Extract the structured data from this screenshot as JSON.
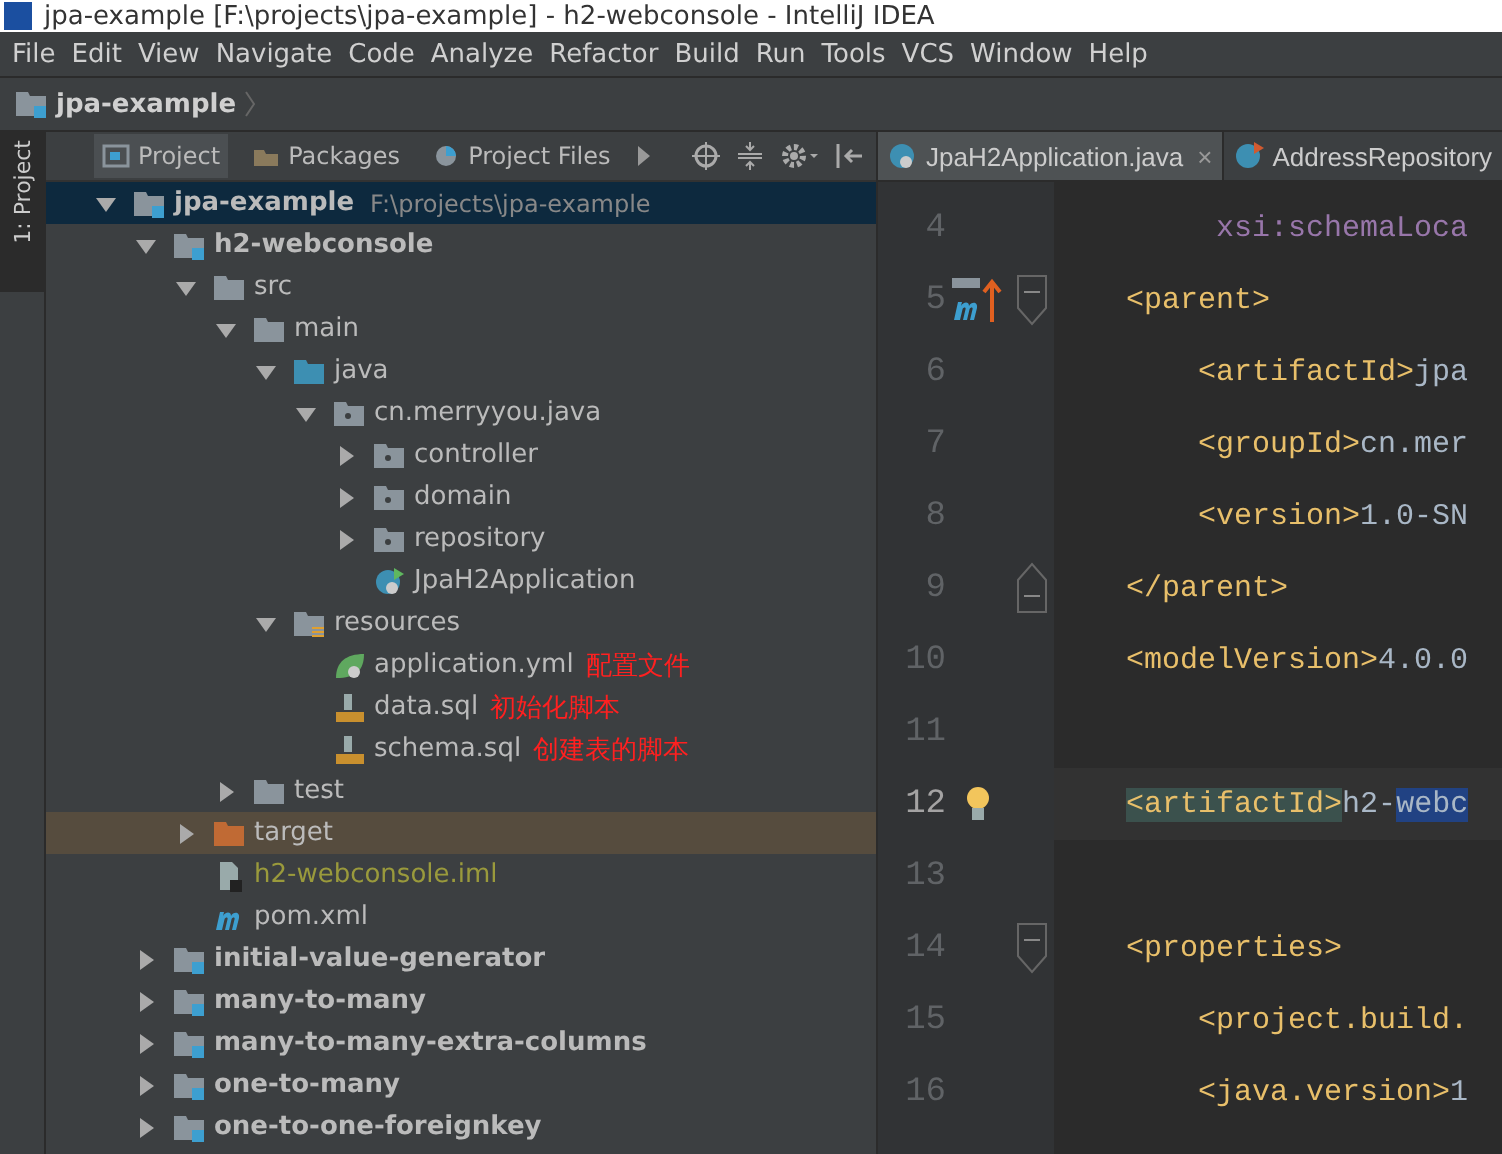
{
  "window": {
    "title": "jpa-example [F:\\projects\\jpa-example] - h2-webconsole - IntelliJ IDEA"
  },
  "menu": [
    "File",
    "Edit",
    "View",
    "Navigate",
    "Code",
    "Analyze",
    "Refactor",
    "Build",
    "Run",
    "Tools",
    "VCS",
    "Window",
    "Help"
  ],
  "breadcrumb": {
    "label": "jpa-example"
  },
  "side_strip": {
    "label": "1: Project"
  },
  "project_panel": {
    "tabs": [
      {
        "label": "Project",
        "selected": true
      },
      {
        "label": "Packages",
        "selected": false
      },
      {
        "label": "Project Files",
        "selected": false
      }
    ],
    "tree": [
      {
        "name": "jpa-example",
        "path": "F:\\projects\\jpa-example",
        "kind": "module",
        "expanded": true,
        "selected": true,
        "hovered": false,
        "children": [
          {
            "name": "h2-webconsole",
            "kind": "module",
            "expanded": true,
            "selected": false,
            "hovered": false,
            "children": [
              {
                "name": "src",
                "kind": "folder",
                "expanded": true,
                "selected": false,
                "hovered": false,
                "children": [
                  {
                    "name": "main",
                    "kind": "folder",
                    "expanded": true,
                    "selected": false,
                    "hovered": false,
                    "children": [
                      {
                        "name": "java",
                        "kind": "source",
                        "expanded": true,
                        "selected": false,
                        "hovered": false,
                        "children": [
                          {
                            "name": "cn.merryyou.java",
                            "kind": "package",
                            "expanded": true,
                            "selected": false,
                            "hovered": false,
                            "children": [
                              {
                                "name": "controller",
                                "kind": "package",
                                "expanded": false,
                                "selected": false,
                                "hovered": false
                              },
                              {
                                "name": "domain",
                                "kind": "package",
                                "expanded": false,
                                "selected": false,
                                "hovered": false
                              },
                              {
                                "name": "repository",
                                "kind": "package",
                                "expanded": false,
                                "selected": false,
                                "hovered": false
                              },
                              {
                                "name": "JpaH2Application",
                                "kind": "class",
                                "selected": false,
                                "hovered": false
                              }
                            ]
                          }
                        ]
                      },
                      {
                        "name": "resources",
                        "kind": "resources",
                        "expanded": true,
                        "selected": false,
                        "hovered": false,
                        "children": [
                          {
                            "name": "application.yml",
                            "kind": "yml",
                            "note": "配置文件",
                            "selected": false,
                            "hovered": false
                          },
                          {
                            "name": "data.sql",
                            "kind": "sql",
                            "note": "初始化脚本",
                            "selected": false,
                            "hovered": false
                          },
                          {
                            "name": "schema.sql",
                            "kind": "sql",
                            "note": "创建表的脚本",
                            "selected": false,
                            "hovered": false
                          }
                        ]
                      }
                    ]
                  },
                  {
                    "name": "test",
                    "kind": "folder",
                    "expanded": false,
                    "selected": false,
                    "hovered": false
                  }
                ]
              },
              {
                "name": "target",
                "kind": "excluded",
                "expanded": false,
                "selected": false,
                "hovered": true
              },
              {
                "name": "h2-webconsole.iml",
                "kind": "iml",
                "selected": false,
                "hovered": false
              },
              {
                "name": "pom.xml",
                "kind": "pom",
                "selected": false,
                "hovered": false
              }
            ]
          },
          {
            "name": "initial-value-generator",
            "kind": "module",
            "expanded": false,
            "selected": false,
            "hovered": false
          },
          {
            "name": "many-to-many",
            "kind": "module",
            "expanded": false,
            "selected": false,
            "hovered": false
          },
          {
            "name": "many-to-many-extra-columns",
            "kind": "module",
            "expanded": false,
            "selected": false,
            "hovered": false
          },
          {
            "name": "one-to-many",
            "kind": "module",
            "expanded": false,
            "selected": false,
            "hovered": false
          },
          {
            "name": "one-to-one-foreignkey",
            "kind": "module",
            "expanded": false,
            "selected": false,
            "hovered": false
          }
        ]
      }
    ]
  },
  "editor": {
    "tabs": [
      {
        "label": "JpaH2Application.java",
        "kind": "spring",
        "close": "×",
        "selected": true
      },
      {
        "label": "AddressRepository",
        "kind": "interface",
        "selected": false
      }
    ],
    "lines": [
      {
        "number": "4",
        "current": false,
        "segments": [
          {
            "kind": "attr",
            "text": "         xsi:schemaLoca"
          }
        ]
      },
      {
        "number": "5",
        "current": false,
        "gutter_icon": {
          "kind": "maven"
        },
        "fold": {
          "kind": "start"
        },
        "segments": [
          {
            "kind": "tag",
            "text": "    <parent>"
          }
        ]
      },
      {
        "number": "6",
        "current": false,
        "segments": [
          {
            "kind": "tag",
            "text": "        <artifactId>"
          },
          {
            "kind": "text",
            "text": "jpa"
          }
        ]
      },
      {
        "number": "7",
        "current": false,
        "segments": [
          {
            "kind": "tag",
            "text": "        <groupId>"
          },
          {
            "kind": "text",
            "text": "cn.mer"
          }
        ]
      },
      {
        "number": "8",
        "current": false,
        "segments": [
          {
            "kind": "tag",
            "text": "        <version>"
          },
          {
            "kind": "text",
            "text": "1.0-SN"
          }
        ]
      },
      {
        "number": "9",
        "current": false,
        "fold": {
          "kind": "end"
        },
        "segments": [
          {
            "kind": "tag",
            "text": "    </parent>"
          }
        ]
      },
      {
        "number": "10",
        "current": false,
        "segments": [
          {
            "kind": "tag",
            "text": "    <modelVersion>"
          },
          {
            "kind": "text",
            "text": "4.0.0"
          }
        ]
      },
      {
        "number": "11",
        "current": false
      },
      {
        "number": "12",
        "current": true,
        "gutter_icon": {
          "kind": "bulb"
        },
        "segments": [
          {
            "kind": "match",
            "text": "    <artifactId>"
          },
          {
            "kind": "text",
            "text": "h2-"
          },
          {
            "kind": "selected",
            "text": "webc"
          }
        ]
      },
      {
        "number": "13",
        "current": false
      },
      {
        "number": "14",
        "current": false,
        "fold": {
          "kind": "start"
        },
        "segments": [
          {
            "kind": "tag",
            "text": "    <properties>"
          }
        ]
      },
      {
        "number": "15",
        "current": false,
        "segments": [
          {
            "kind": "tag",
            "text": "        <project.build."
          }
        ]
      },
      {
        "number": "16",
        "current": false,
        "segments": [
          {
            "kind": "tag",
            "text": "        <java.version>"
          },
          {
            "kind": "text",
            "text": "1"
          }
        ]
      }
    ]
  }
}
